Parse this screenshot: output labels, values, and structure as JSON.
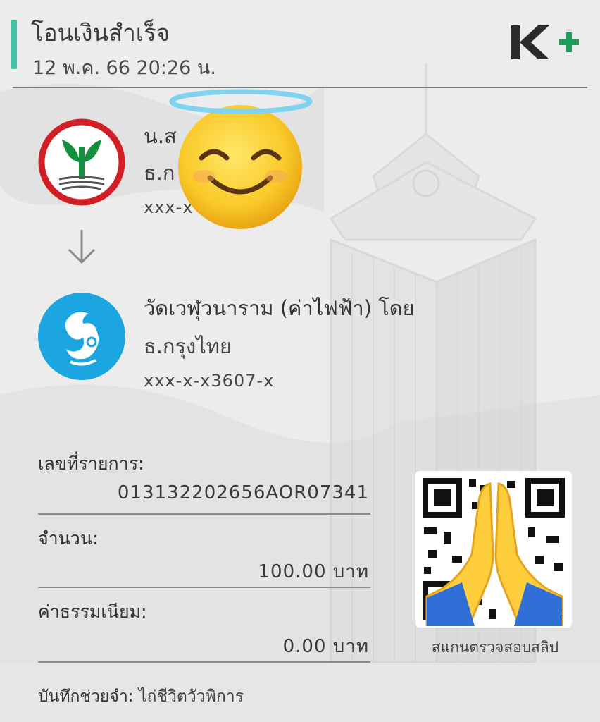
{
  "header": {
    "title": "โอนเงินสำเร็จ",
    "datetime": "12 พ.ค. 66  20:26 น.",
    "logo_text": "K+",
    "accent_color": "#3cc3a8",
    "logo_color": "#1e9d5a"
  },
  "sender": {
    "name": "น.ส",
    "bank": "ธ.ก",
    "account": "xxx-x",
    "logo": "kasikorn-bank-logo"
  },
  "receiver": {
    "name": "วัดเวฬุวนาราม (ค่าไฟฟ้า) โดย",
    "bank": "ธ.กรุงไทย",
    "account": "xxx-x-x3607-x",
    "logo": "krungthai-bank-logo"
  },
  "fields": {
    "ref_label": "เลขที่รายการ:",
    "ref_value": "013132202656AOR07341",
    "amount_label": "จำนวน:",
    "amount_value": "100.00 บาท",
    "fee_label": "ค่าธรรมเนียม:",
    "fee_value": "0.00 บาท"
  },
  "qr": {
    "caption": "สแกนตรวจสอบสลิป"
  },
  "memo": {
    "label": "บันทึกช่วยจำ:",
    "value": "ไถ่ชีวิตวัวพิการ"
  },
  "stickers": [
    "halo-smile-emoji",
    "praying-hands-emoji"
  ]
}
